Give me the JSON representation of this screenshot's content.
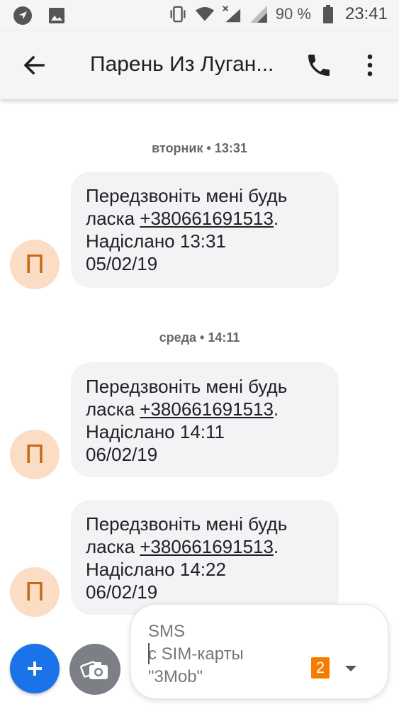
{
  "status_bar": {
    "left_icons": [
      "navigation-icon",
      "image-icon"
    ],
    "right_icons": [
      "vibrate-icon",
      "wifi-icon",
      "no-signal-icon",
      "signal-icon",
      "battery-icon"
    ],
    "battery_percent": "90 %",
    "time": "23:41"
  },
  "app_bar": {
    "title": "Парень Из Луган...",
    "back_icon": "arrow-back-icon",
    "call_icon": "phone-icon",
    "menu_icon": "more-vert-icon"
  },
  "conversation": {
    "date_separators": [
      "вторник • 13:31",
      "среда • 14:11"
    ],
    "avatar_letter": "П",
    "messages": [
      {
        "line1": "Передзвоніть мені будь",
        "line2_prefix": "ласка ",
        "phone": "+380661691513",
        "line2_suffix": ".",
        "line3": "Надіслано 13:31",
        "line4": "05/02/19"
      },
      {
        "line1": "Передзвоніть мені будь",
        "line2_prefix": "ласка ",
        "phone": "+380661691513",
        "line2_suffix": ".",
        "line3": "Надіслано 14:11",
        "line4": "06/02/19"
      },
      {
        "line1": "Передзвоніть мені будь",
        "line2_prefix": "ласка ",
        "phone": "+380661691513",
        "line2_suffix": ".",
        "line3": "Надіслано 14:22",
        "line4": "06/02/19"
      }
    ]
  },
  "compose": {
    "placeholder_line1": "SMS",
    "placeholder_line2": "с SIM-карты",
    "placeholder_line3": "\"3Mob\"",
    "sim_number": "2",
    "sim_badge_color": "#f57c00"
  },
  "colors": {
    "accent": "#1a73e8",
    "avatar_bg": "#fbdcc4",
    "avatar_fg": "#c56a16",
    "bubble_bg": "#f1f3f4"
  }
}
